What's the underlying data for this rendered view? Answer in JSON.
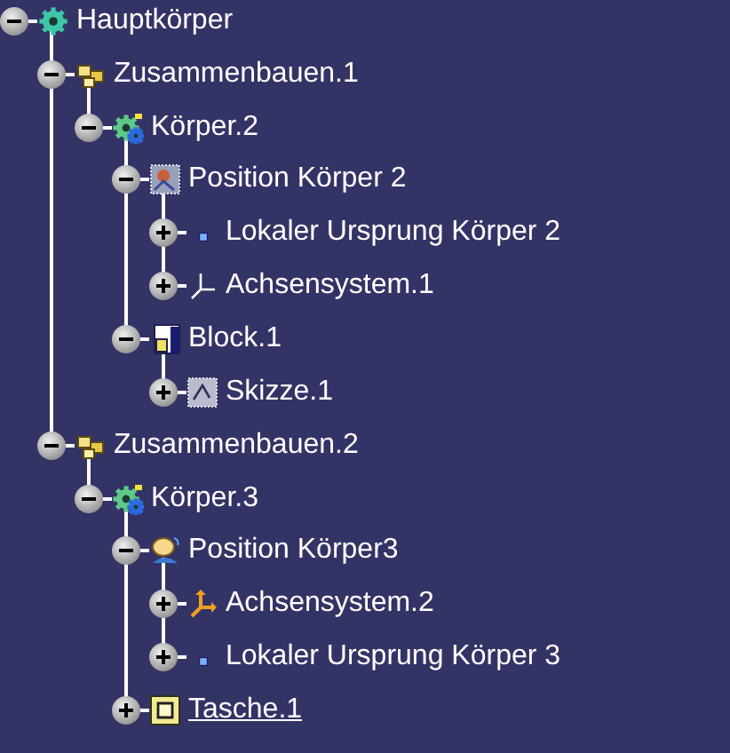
{
  "tree": [
    {
      "label": "Hauptkörper",
      "kind": "body",
      "expanded": true,
      "current": false,
      "children": [
        {
          "label": "Zusammenbauen.1",
          "kind": "assembly",
          "expanded": true,
          "current": false,
          "children": [
            {
              "label": "Körper.2",
              "kind": "body-new",
              "expanded": true,
              "current": false,
              "children": [
                {
                  "label": "Position Körper 2",
                  "kind": "position",
                  "expanded": true,
                  "current": false,
                  "children": [
                    {
                      "label": "Lokaler Ursprung Körper 2",
                      "kind": "origin",
                      "expanded": false,
                      "current": false
                    },
                    {
                      "label": "Achsensystem.1",
                      "kind": "axis",
                      "expanded": false,
                      "current": false
                    }
                  ]
                },
                {
                  "label": "Block.1",
                  "kind": "block",
                  "expanded": true,
                  "current": false,
                  "children": [
                    {
                      "label": "Skizze.1",
                      "kind": "sketch",
                      "expanded": false,
                      "current": false
                    }
                  ]
                }
              ]
            }
          ]
        },
        {
          "label": "Zusammenbauen.2",
          "kind": "assembly",
          "expanded": true,
          "current": false,
          "children": [
            {
              "label": "Körper.3",
              "kind": "body-new",
              "expanded": true,
              "current": false,
              "children": [
                {
                  "label": "Position Körper3",
                  "kind": "position-alt",
                  "expanded": true,
                  "current": false,
                  "children": [
                    {
                      "label": "Achsensystem.2",
                      "kind": "axis-alt",
                      "expanded": false,
                      "current": false
                    },
                    {
                      "label": "Lokaler Ursprung Körper 3",
                      "kind": "origin",
                      "expanded": false,
                      "current": false
                    }
                  ]
                },
                {
                  "label": "Tasche.1",
                  "kind": "pocket",
                  "expanded": false,
                  "current": true
                }
              ]
            }
          ]
        }
      ]
    }
  ]
}
